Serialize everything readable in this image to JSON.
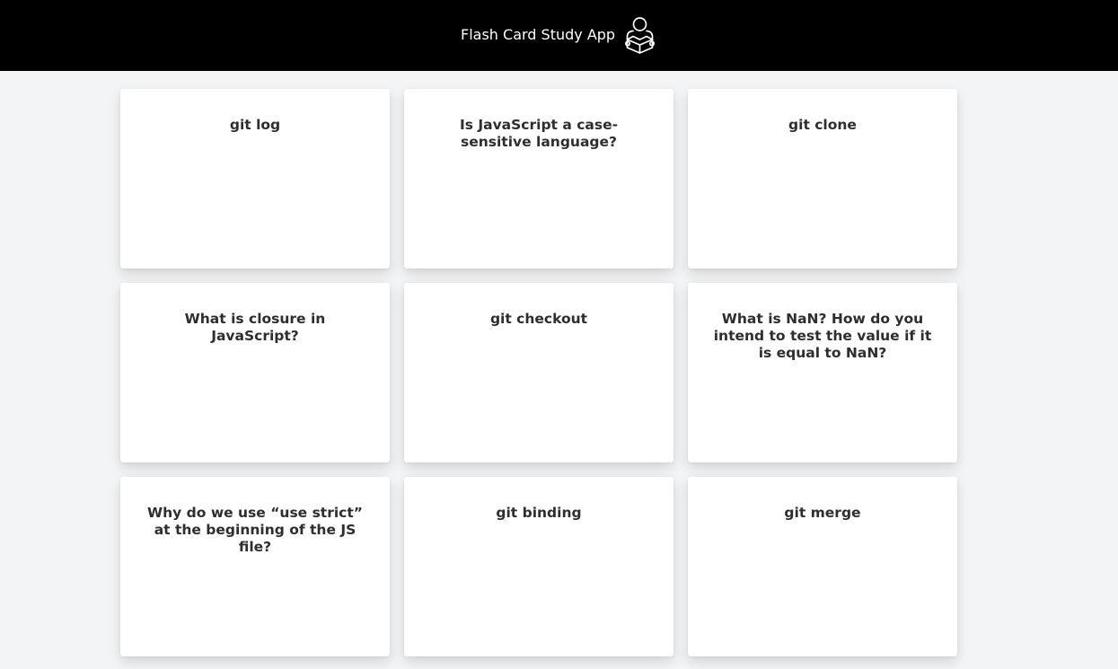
{
  "header": {
    "title": "Flash Card Study App",
    "logo_icon": "reader-with-book-icon"
  },
  "colors": {
    "header_bg": "#000000",
    "page_bg": "#f3f4f5",
    "card_bg": "#ffffff",
    "card_text": "#2e2e2e"
  },
  "cards": [
    {
      "question": "git log"
    },
    {
      "question": "Is JavaScript a case-sensitive language?"
    },
    {
      "question": "git clone"
    },
    {
      "question": "What is closure in JavaScript?"
    },
    {
      "question": "git checkout"
    },
    {
      "question": "What is NaN? How do you intend to test the value if it is equal to NaN?"
    },
    {
      "question": "Why do we use “use strict” at the beginning of the JS file?"
    },
    {
      "question": "git binding"
    },
    {
      "question": "git merge"
    }
  ]
}
